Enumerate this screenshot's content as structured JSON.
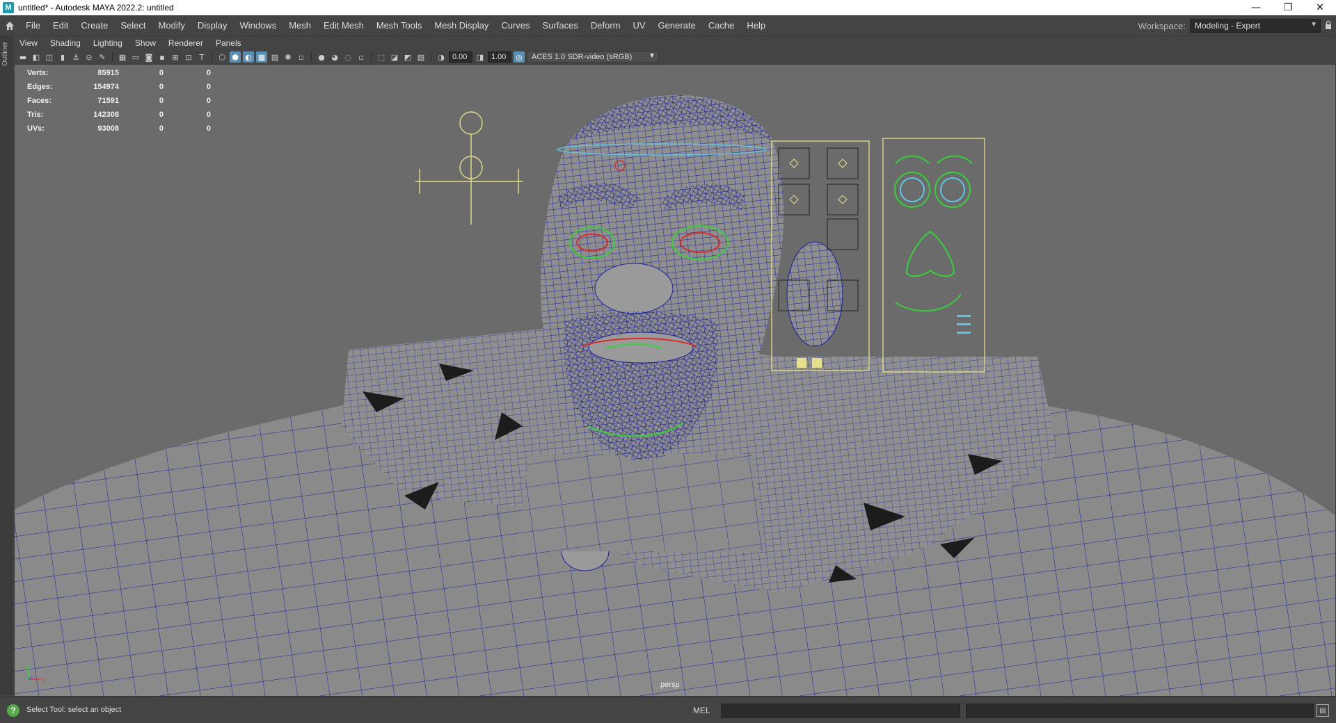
{
  "window": {
    "app_icon": "M",
    "title": "untitled* - Autodesk MAYA 2022.2: untitled",
    "minimize_glyph": "—",
    "restore_glyph": "❐",
    "close_glyph": "✕"
  },
  "menubar": {
    "items": [
      "File",
      "Edit",
      "Create",
      "Select",
      "Modify",
      "Display",
      "Windows",
      "Mesh",
      "Edit Mesh",
      "Mesh Tools",
      "Mesh Display",
      "Curves",
      "Surfaces",
      "Deform",
      "UV",
      "Generate",
      "Cache",
      "Help"
    ],
    "workspace_label": "Workspace:",
    "workspace_value": "Modeling - Expert"
  },
  "outliner_tab": "Outliner",
  "panel_menu": [
    "View",
    "Shading",
    "Lighting",
    "Show",
    "Renderer",
    "Panels"
  ],
  "panel_toolbar": {
    "exposure": "0.00",
    "gamma": "1.00",
    "color_space": "ACES 1.0 SDR-video (sRGB)"
  },
  "heads_up": {
    "rows": [
      {
        "label": "Verts:",
        "values": [
          "85915",
          "0",
          "0"
        ]
      },
      {
        "label": "Edges:",
        "values": [
          "154974",
          "0",
          "0"
        ]
      },
      {
        "label": "Faces:",
        "values": [
          "71591",
          "0",
          "0"
        ]
      },
      {
        "label": "Tris:",
        "values": [
          "142308",
          "0",
          "0"
        ]
      },
      {
        "label": "UVs:",
        "values": [
          "93008",
          "0",
          "0"
        ]
      }
    ]
  },
  "camera_label": "persp",
  "axis": {
    "y": "y",
    "x": "x"
  },
  "statusbar": {
    "help_text": "Select Tool: select an object",
    "language": "MEL"
  },
  "colors": {
    "viewport_bg": "#6b6b6b",
    "wireframe": "#1a1f9e",
    "control_yellow": "#e6e08a",
    "control_green": "#36d13a",
    "control_red": "#d82a2a",
    "control_cyan": "#5fc6e8"
  }
}
